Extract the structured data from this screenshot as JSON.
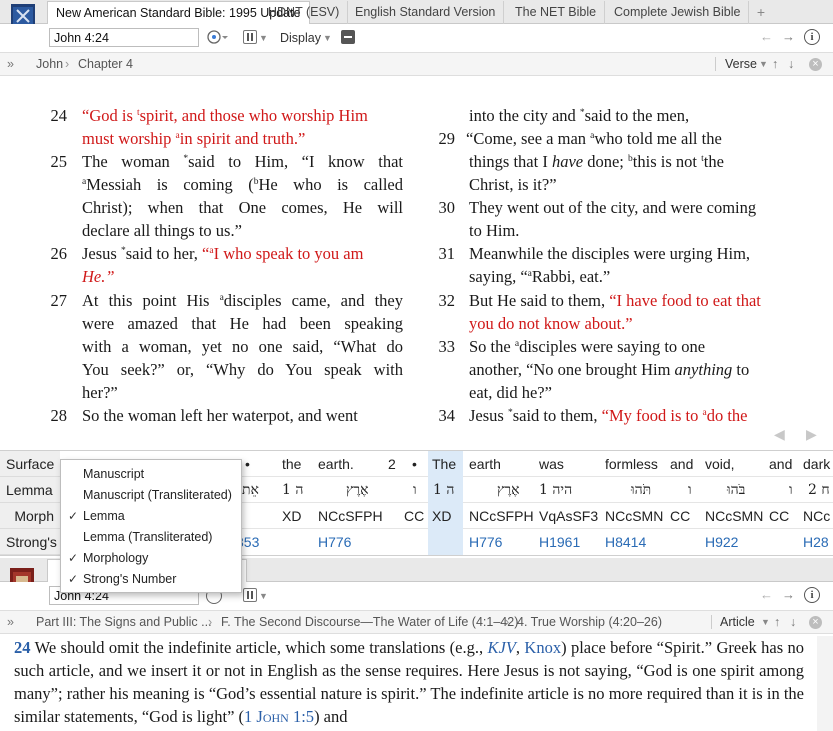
{
  "top": {
    "tabs": [
      "New American Standard Bible: 1995 Update",
      "HDNT (ESV)",
      "English Standard Version",
      "The NET Bible",
      "Complete Jewish Bible"
    ],
    "new_tab": "+",
    "panel_badge": "A",
    "reference": "John 4:24",
    "display_label": "Display",
    "crumbs": [
      "»",
      "John",
      "›",
      "Chapter 4"
    ],
    "sync_label": "Verse",
    "close_glyph": "×"
  },
  "bible_left": [
    {
      "num": "24",
      "lines": [
        [
          "red",
          "“God is "
        ],
        [
          "sup",
          "t"
        ],
        [
          "red",
          "spirit, and those who worship Him"
        ]
      ],
      "line2": "must worship ",
      "l2sup": "a",
      "l2rest": "in spirit and truth.”"
    },
    {
      "num": "25",
      "l1": "The woman ",
      "l1sup": "*",
      "l1rest": "said to Him, “I know that",
      "l2sup": "a",
      "l2": "Messiah is coming (",
      "l2sup2": "b",
      "l2rest": "He who is called",
      "l3": "Christ); when that One comes, He will",
      "l4": "declare all things to us.”"
    },
    {
      "num": "26",
      "l1": "Jesus ",
      "l1sup": "*",
      "l1rest": "said to her, ",
      "red1": "“",
      "red1sup": "a",
      "red1rest": "I who speak to you am",
      "l2red": "He.”"
    },
    {
      "num": "27",
      "l1": "At this point His ",
      "l1sup": "a",
      "l1rest": "disciples came, and they",
      "l2": "were amazed that He had been speaking",
      "l3": "with a woman, yet no one said, “What do",
      "l4": "You seek?” or, “Why do You speak with",
      "l5": "her?”"
    },
    {
      "num": "28",
      "l1": "So the woman left her waterpot, and went"
    }
  ],
  "bible_right": [
    {
      "cont": "into the city and ",
      "sup": "*",
      "rest": "said to the men,"
    },
    {
      "num": "29",
      "l1": "“Come, see a man ",
      "l1sup": "a",
      "l1rest": "who told me all the",
      "l2": "things that I ",
      "l2it": "have",
      "l2b": " done; ",
      "l2sup": "b",
      "l2c": "this is not ",
      "l2sup2": "t",
      "l2d": "the",
      "l3": "Christ, is it?”"
    },
    {
      "num": "30",
      "l1": "They went out of the city, and were coming",
      "l2": "to Him."
    },
    {
      "num": "31",
      "l1": "Meanwhile the disciples were urging Him,",
      "l2": "saying, “",
      "l2sup": "a",
      "l2rest": "Rabbi, eat.”"
    },
    {
      "num": "32",
      "l1": "But He said to them, ",
      "red1": "“I have food to eat that",
      "l2red": "you do not know about.”"
    },
    {
      "num": "33",
      "l1": "So the ",
      "l1sup": "a",
      "l1rest": "disciples were saying to one",
      "l2": "another, “No one brought Him ",
      "l2it": "anything",
      "l2b": " to",
      "l3": "eat, did he?”"
    },
    {
      "num": "34",
      "l1": "Jesus ",
      "l1sup": "*",
      "l1rest": "said to them, ",
      "red1": "“My food is to ",
      "red1sup": "a",
      "red1rest": "do the"
    }
  ],
  "interlinear": {
    "row_headers": [
      "Surface",
      "Lemma",
      "Morph",
      "Strong's"
    ],
    "surface": [
      "•",
      "the",
      "earth.",
      "2",
      "•",
      "The",
      "earth",
      "was",
      "formless",
      "and",
      "void,",
      "and",
      "dark"
    ],
    "lemma": [
      "אֵת",
      "ה 1",
      "אֶרֶץ",
      "ו",
      "ה 1",
      "אֶרֶץ",
      "היה 1",
      "תֹּהוּ",
      "ו",
      "בֹּהוּ",
      "ו",
      "2 ח"
    ],
    "morph": [
      "XD",
      "NCcSFPH",
      "CC",
      "XD",
      "NCcSFPH",
      "VqAsSF3",
      "NCcSMN",
      "CC",
      "NCcSMN",
      "CC",
      "NCc"
    ],
    "strongs": [
      "853",
      "H776",
      "H776",
      "H1961",
      "H8414",
      "H922",
      "H28"
    ]
  },
  "menu": [
    {
      "label": "Manuscript",
      "checked": false
    },
    {
      "label": "Manuscript (Transliterated)",
      "checked": false
    },
    {
      "label": "Lemma",
      "checked": true
    },
    {
      "label": "Lemma (Transliterated)",
      "checked": false
    },
    {
      "label": "Morphology",
      "checked": true
    },
    {
      "label": "Strong's Number",
      "checked": true
    }
  ],
  "bottom": {
    "panel_badge": "A",
    "reference": "John 4:24",
    "crumbs": [
      "»",
      "Part III: The Signs and Public ...",
      "›",
      "F. The Second Discourse—The Water of Life (4:1–42)",
      "›",
      "4. True Worship (4:20–26)"
    ],
    "sync_label": "Article",
    "commentary_num": "24",
    "commentary": [
      {
        "t": " We should omit the indefinite article, which some translations (e.g., "
      },
      {
        "b": "KJV"
      },
      {
        "t": ", "
      },
      {
        "b2": "Knox"
      },
      {
        "t": ") place before “Spirit.” Greek has no such article, and we insert it or not in English as the sense requires. Here Jesus is not saying, “God is one spirit among many”; rather his meaning is “God’s essential nature is spirit.” The indefinite article is no more required than it is in the similar statements, “God is light” ("
      },
      {
        "b3": "1 John 1:5"
      },
      {
        "t": ") and"
      }
    ]
  },
  "colors": {
    "words_of_christ": "#d01818",
    "link": "#2a6bb5",
    "highlight": "#dceaf8",
    "badge": "#e8862a"
  }
}
